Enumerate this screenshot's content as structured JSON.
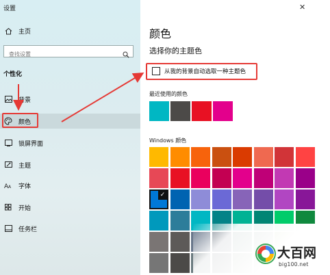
{
  "window": {
    "title": "设置"
  },
  "sidebar": {
    "home": "主页",
    "search_placeholder": "查找设置",
    "section": "个性化",
    "items": [
      {
        "label": "背景",
        "icon": "picture-icon"
      },
      {
        "label": "颜色",
        "icon": "palette-icon"
      },
      {
        "label": "锁屏界面",
        "icon": "lock-screen-icon"
      },
      {
        "label": "主题",
        "icon": "theme-icon"
      },
      {
        "label": "字体",
        "icon": "font-icon"
      },
      {
        "label": "开始",
        "icon": "start-icon"
      },
      {
        "label": "任务栏",
        "icon": "taskbar-icon"
      }
    ]
  },
  "main": {
    "title": "颜色",
    "subtitle": "选择你的主题色",
    "auto_checkbox_label": "从我的背景自动选取一种主题色",
    "recent_heading": "最近使用的颜色",
    "recent_colors": [
      "#00b7c3",
      "#4c4a48",
      "#e81123",
      "#e3008c"
    ],
    "windows_heading": "Windows 颜色",
    "windows_colors": [
      [
        "#ffb900",
        "#ff8c00",
        "#f7630c",
        "#ca5010",
        "#da3b01",
        "#ef6950",
        "#d13438",
        "#ff4343"
      ],
      [
        "#e74856",
        "#e81123",
        "#ea005e",
        "#c30052",
        "#e3008c",
        "#bf0077",
        "#c239b3",
        "#9a0089"
      ],
      [
        "#0078d7",
        "#0063b1",
        "#8e8cd8",
        "#6b69d6",
        "#8764b8",
        "#744da9",
        "#b146c2",
        "#881798"
      ],
      [
        "#0099bc",
        "#2d7d9a",
        "#00b7c3",
        "#038387",
        "#00b294",
        "#018574",
        "#00cc6a",
        "#10893e"
      ],
      [
        "#7a7574",
        "#5d5a58",
        "#68768a",
        "#515c6b",
        "#567c73",
        "#486860",
        "#498205",
        "#107c10"
      ],
      [
        "#767676",
        "#4c4a48",
        "#69797e",
        "#4a5459",
        "#647c64",
        "#525e54",
        "#847545",
        "#7e735f"
      ]
    ],
    "selected_swatch": "#0078d7"
  },
  "watermark": {
    "name": "大百网",
    "url": "big100.net"
  },
  "annotation_color": "#e53935"
}
